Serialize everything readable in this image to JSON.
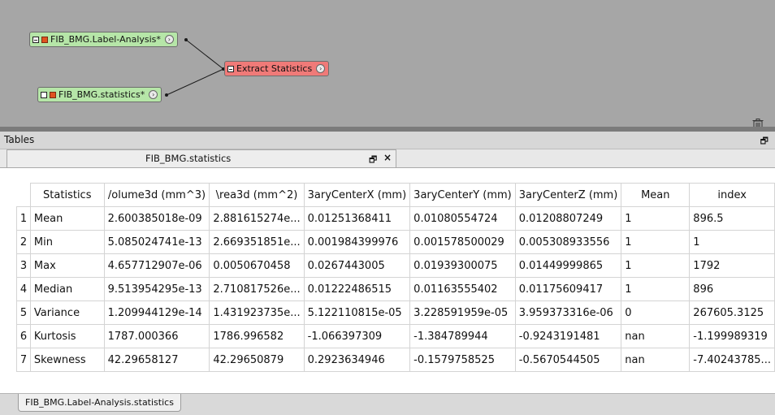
{
  "graph": {
    "nodes": [
      {
        "label": "FIB_BMG.Label-Analysis*",
        "port": "›"
      },
      {
        "label": "FIB_BMG.statistics*",
        "port": "›"
      },
      {
        "label": "Extract Statistics",
        "port": "›"
      }
    ]
  },
  "tables_panel": {
    "title": "Tables",
    "float_glyph": "🗗",
    "doc_tab": {
      "label": "FIB_BMG.statistics",
      "float_glyph": "🗗",
      "close_glyph": "×"
    }
  },
  "table": {
    "columns": [
      "Statistics",
      "/olume3d (mm^3)",
      "\\rea3d (mm^2)",
      "3aryCenterX (mm)",
      "3aryCenterY (mm)",
      "3aryCenterZ (mm)",
      "Mean",
      "index"
    ],
    "rows": [
      {
        "num": "1",
        "cells": [
          "Mean",
          "2.600385018e-09",
          "2.881615274e...",
          "0.01251368411",
          "0.01080554724",
          "0.01208807249",
          "1",
          "896.5"
        ]
      },
      {
        "num": "2",
        "cells": [
          "Min",
          "5.085024741e-13",
          "2.669351851e...",
          "0.001984399976",
          "0.001578500029",
          "0.005308933556",
          "1",
          "1"
        ]
      },
      {
        "num": "3",
        "cells": [
          "Max",
          "4.657712907e-06",
          "0.0050670458",
          "0.0267443005",
          "0.01939300075",
          "0.01449999865",
          "1",
          "1792"
        ]
      },
      {
        "num": "4",
        "cells": [
          "Median",
          "9.513954295e-13",
          "2.710817526e...",
          "0.01222486515",
          "0.01163555402",
          "0.01175609417",
          "1",
          "896"
        ]
      },
      {
        "num": "5",
        "cells": [
          "Variance",
          "1.209944129e-14",
          "1.431923735e...",
          "5.122110815e-05",
          "3.228591959e-05",
          "3.959373316e-06",
          "0",
          "267605.3125"
        ]
      },
      {
        "num": "6",
        "cells": [
          "Kurtosis",
          "1787.000366",
          "1786.996582",
          "-1.066397309",
          "-1.384789944",
          "-0.9243191481",
          "nan",
          "-1.199989319"
        ]
      },
      {
        "num": "7",
        "cells": [
          "Skewness",
          "42.29658127",
          "42.29650879",
          "0.2923634946",
          "-0.1579758525",
          "-0.5670544505",
          "nan",
          "-7.40243785..."
        ]
      }
    ]
  },
  "bottom_tab": {
    "label": "FIB_BMG.Label-Analysis.statistics"
  }
}
